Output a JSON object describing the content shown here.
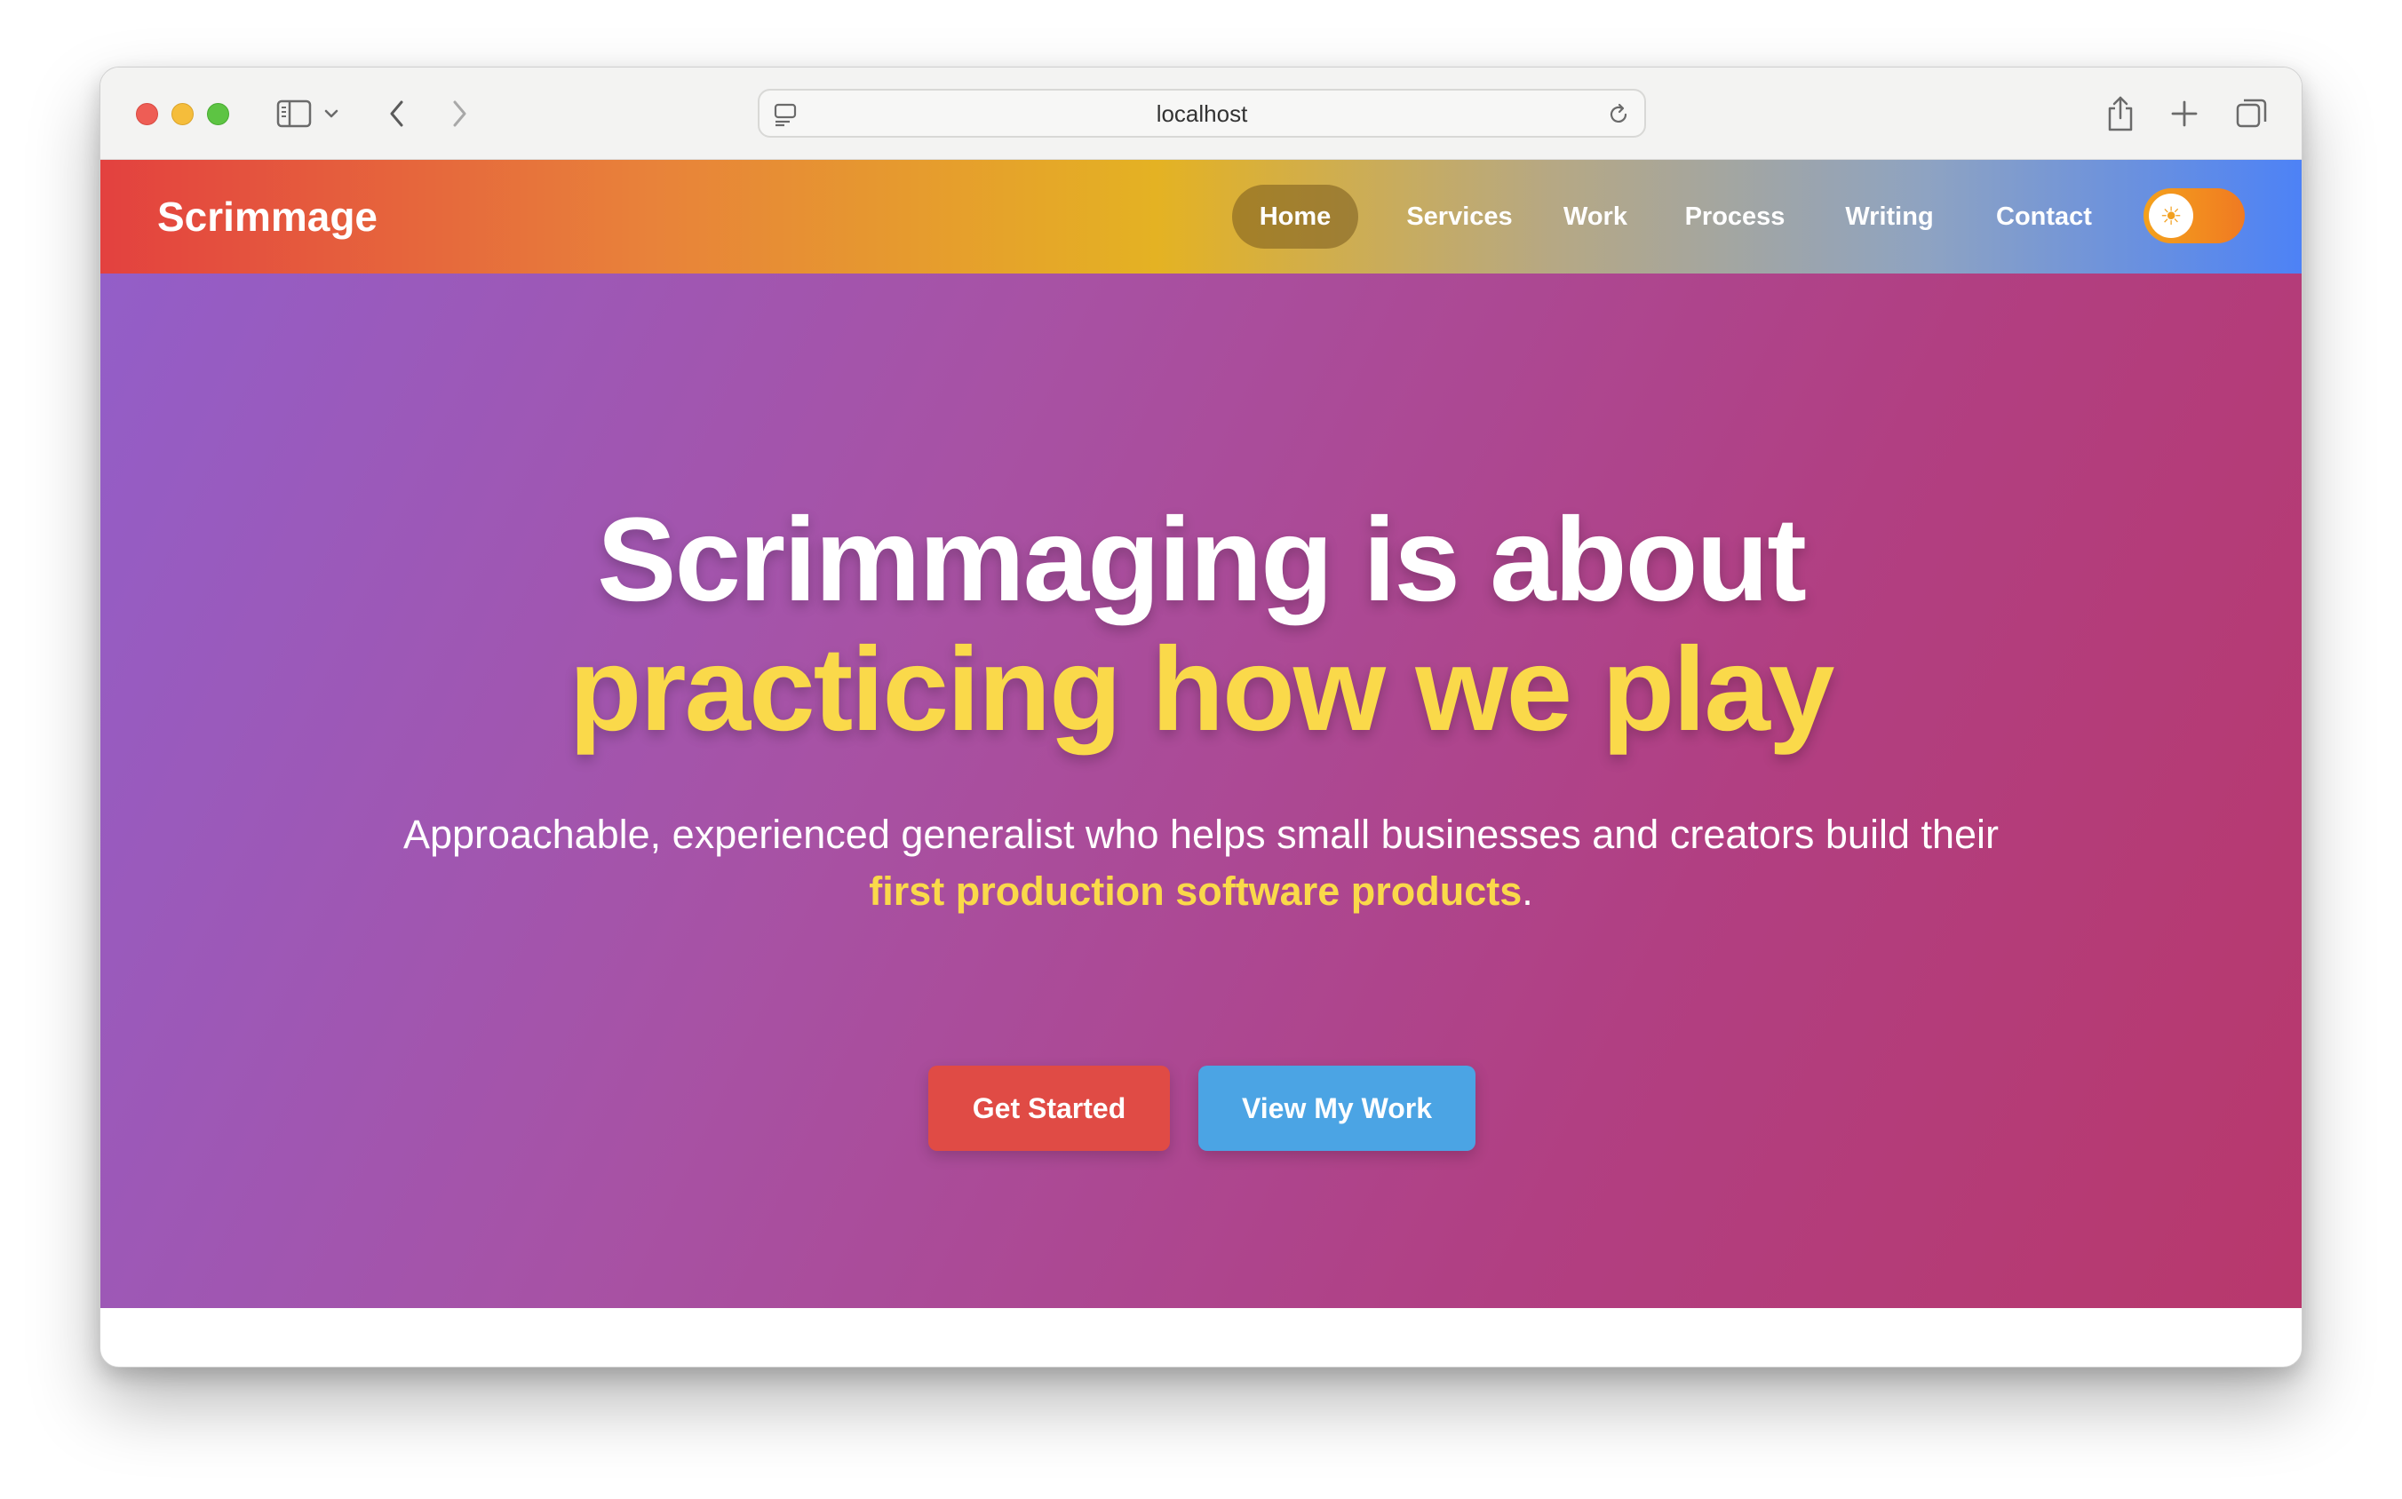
{
  "browser": {
    "url": "localhost",
    "icons": {
      "sidebar": "sidebar-icon",
      "tab_dropdown": "chevron-down-icon",
      "back": "chevron-left-icon",
      "forward": "chevron-right-icon",
      "site_settings": "site-settings-icon",
      "reload": "reload-icon",
      "share": "share-icon",
      "new_tab": "plus-icon",
      "tabs_overview": "tabs-overview-icon"
    }
  },
  "site": {
    "brand": "Scrimmage",
    "nav": [
      {
        "label": "Home",
        "active": true
      },
      {
        "label": "Services",
        "active": false
      },
      {
        "label": "Work",
        "active": false
      },
      {
        "label": "Process",
        "active": false
      },
      {
        "label": "Writing",
        "active": false
      },
      {
        "label": "Contact",
        "active": false
      }
    ],
    "theme_toggle_icon": "sun-icon"
  },
  "hero": {
    "title_line1": "Scrimmaging is about",
    "title_line2": "practicing how we play",
    "subtitle_prefix": "Approachable, experienced generalist who helps small businesses and creators build their",
    "subtitle_highlight": "first production software products",
    "subtitle_suffix": ".",
    "primary_button": "Get Started",
    "secondary_button": "View My Work"
  },
  "colors": {
    "accent_yellow": "#fad94a",
    "primary_button": "#e04b45",
    "secondary_button": "#4ba4e4",
    "hero_gradient_start": "#935ec8",
    "hero_gradient_end": "#b8386c"
  }
}
